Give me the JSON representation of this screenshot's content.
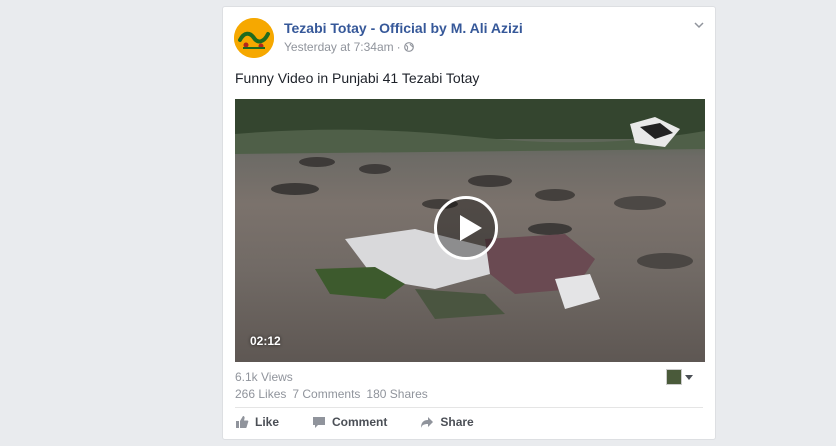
{
  "post": {
    "page_name": "Tezabi Totay - Official by M. Ali Azizi",
    "timestamp": "Yesterday at 7:34am",
    "separator": "·",
    "privacy_icon": "globe-icon",
    "text": "Funny Video in Punjabi 41 Tezabi Totay",
    "avatar_color": "#f6a800",
    "link_color": "#365899"
  },
  "video": {
    "duration": "02:12",
    "play_icon": "play-icon"
  },
  "stats": {
    "views": "6.1k Views",
    "likes": "266 Likes",
    "comments": "7 Comments",
    "shares": "180 Shares"
  },
  "actions": {
    "like": "Like",
    "comment": "Comment",
    "share": "Share"
  }
}
